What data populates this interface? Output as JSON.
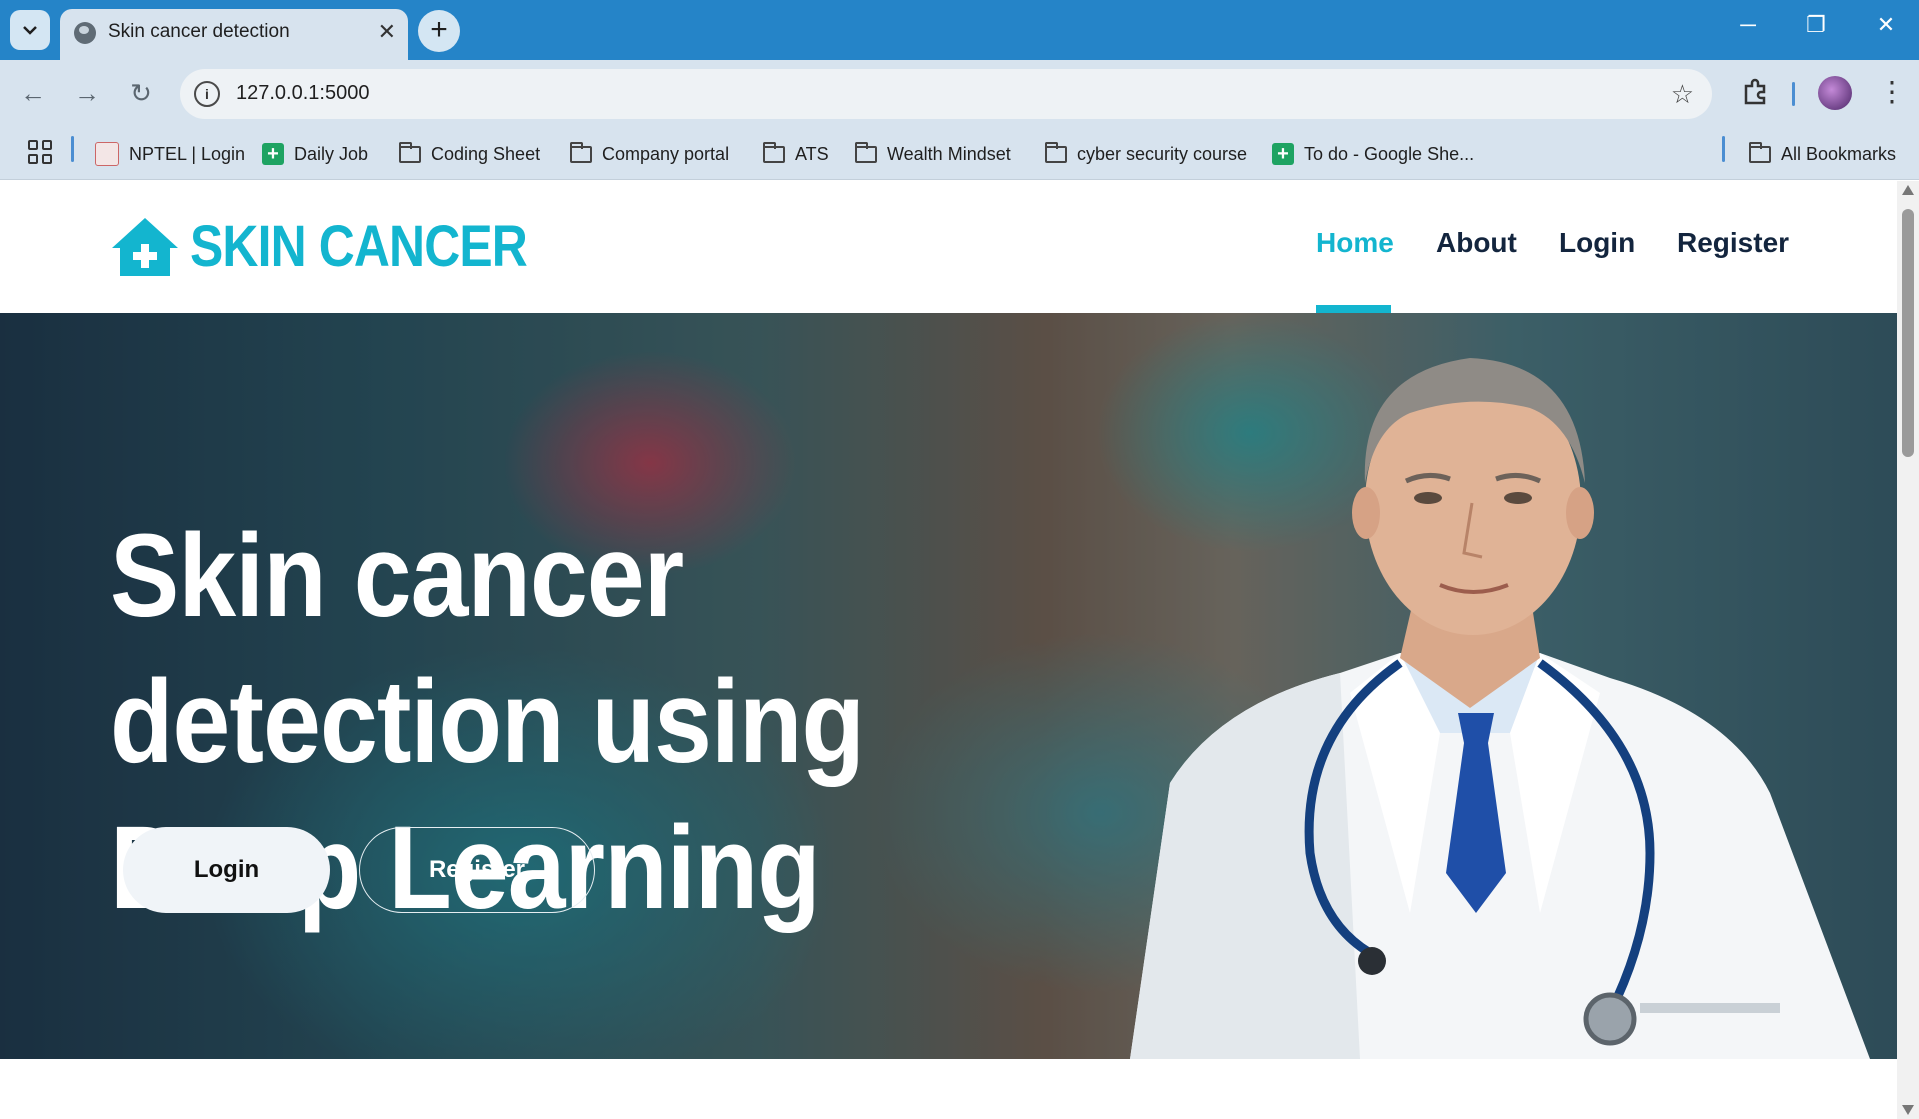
{
  "browser": {
    "tab_title": "Skin cancer detection",
    "url": "127.0.0.1:5000",
    "bookmarks": [
      {
        "label": "NPTEL | Login",
        "icon": "nptel-icon"
      },
      {
        "label": "Daily Job",
        "icon": "sheets-icon"
      },
      {
        "label": "Coding Sheet",
        "icon": "folder-icon"
      },
      {
        "label": "Company portal",
        "icon": "folder-icon"
      },
      {
        "label": "ATS",
        "icon": "folder-icon"
      },
      {
        "label": "Wealth Mindset",
        "icon": "folder-icon"
      },
      {
        "label": "cyber security course",
        "icon": "folder-icon"
      },
      {
        "label": "To do - Google She...",
        "icon": "sheets-icon"
      }
    ],
    "all_bookmarks": "All Bookmarks"
  },
  "site": {
    "logo_text": "SKIN CANCER",
    "brand_color": "#13b5cf",
    "nav": {
      "home": "Home",
      "about": "About",
      "login": "Login",
      "register": "Register"
    },
    "hero": {
      "title": "Skin cancer detection using Deep Learning",
      "login_button": "Login",
      "register_button": "Register"
    }
  }
}
